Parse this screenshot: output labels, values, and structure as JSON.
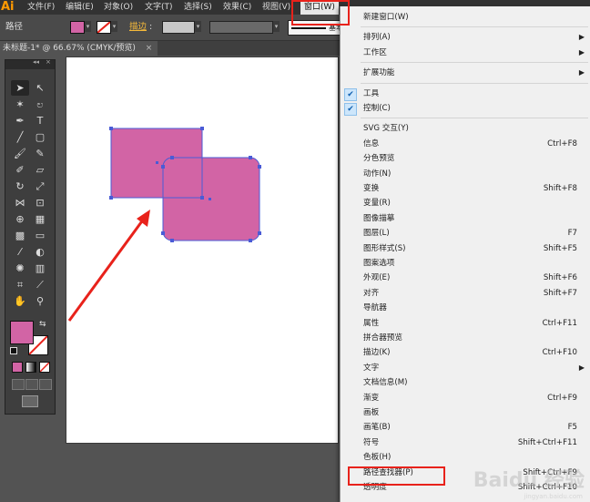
{
  "menubar": {
    "logo": "Ai",
    "items": [
      "文件(F)",
      "编辑(E)",
      "对象(O)",
      "文字(T)",
      "选择(S)",
      "效果(C)",
      "视图(V)",
      "窗口(W)"
    ]
  },
  "control": {
    "path_label": "路径",
    "stroke_label": "描边",
    "stroke_colon": ":",
    "preset": "基本",
    "fill_color": "#d264a5"
  },
  "tab": {
    "title": "未标题-1* @ 66.67% (CMYK/预览)",
    "close": "×"
  },
  "canvas": {
    "shape_fill": "#d264a5",
    "selection_color": "#4a5bd6",
    "arrow_color": "#e8221b"
  },
  "window_menu": {
    "items": [
      {
        "label": "新建窗口(W)",
        "shortcut": "",
        "submenu": false,
        "checked": false
      },
      {
        "sep": true
      },
      {
        "label": "排列(A)",
        "shortcut": "",
        "submenu": true,
        "checked": false
      },
      {
        "label": "工作区",
        "shortcut": "",
        "submenu": true,
        "checked": false
      },
      {
        "sep": true
      },
      {
        "label": "扩展功能",
        "shortcut": "",
        "submenu": true,
        "checked": false
      },
      {
        "sep": true
      },
      {
        "label": "工具",
        "shortcut": "",
        "submenu": false,
        "checked": true
      },
      {
        "label": "控制(C)",
        "shortcut": "",
        "submenu": false,
        "checked": true
      },
      {
        "sep": true
      },
      {
        "label": "SVG 交互(Y)",
        "shortcut": "",
        "submenu": false,
        "checked": false
      },
      {
        "label": "信息",
        "shortcut": "Ctrl+F8",
        "submenu": false,
        "checked": false
      },
      {
        "label": "分色预览",
        "shortcut": "",
        "submenu": false,
        "checked": false
      },
      {
        "label": "动作(N)",
        "shortcut": "",
        "submenu": false,
        "checked": false
      },
      {
        "label": "变换",
        "shortcut": "Shift+F8",
        "submenu": false,
        "checked": false
      },
      {
        "label": "变量(R)",
        "shortcut": "",
        "submenu": false,
        "checked": false
      },
      {
        "label": "图像描摹",
        "shortcut": "",
        "submenu": false,
        "checked": false
      },
      {
        "label": "图层(L)",
        "shortcut": "F7",
        "submenu": false,
        "checked": false
      },
      {
        "label": "图形样式(S)",
        "shortcut": "Shift+F5",
        "submenu": false,
        "checked": false
      },
      {
        "label": "图案选项",
        "shortcut": "",
        "submenu": false,
        "checked": false
      },
      {
        "label": "外观(E)",
        "shortcut": "Shift+F6",
        "submenu": false,
        "checked": false
      },
      {
        "label": "对齐",
        "shortcut": "Shift+F7",
        "submenu": false,
        "checked": false
      },
      {
        "label": "导航器",
        "shortcut": "",
        "submenu": false,
        "checked": false
      },
      {
        "label": "属性",
        "shortcut": "Ctrl+F11",
        "submenu": false,
        "checked": false
      },
      {
        "label": "拼合器预览",
        "shortcut": "",
        "submenu": false,
        "checked": false
      },
      {
        "label": "描边(K)",
        "shortcut": "Ctrl+F10",
        "submenu": false,
        "checked": false
      },
      {
        "label": "文字",
        "shortcut": "",
        "submenu": true,
        "checked": false
      },
      {
        "label": "文档信息(M)",
        "shortcut": "",
        "submenu": false,
        "checked": false
      },
      {
        "label": "渐变",
        "shortcut": "Ctrl+F9",
        "submenu": false,
        "checked": false
      },
      {
        "label": "画板",
        "shortcut": "",
        "submenu": false,
        "checked": false
      },
      {
        "label": "画笔(B)",
        "shortcut": "F5",
        "submenu": false,
        "checked": false
      },
      {
        "label": "符号",
        "shortcut": "Shift+Ctrl+F11",
        "submenu": false,
        "checked": false
      },
      {
        "label": "色板(H)",
        "shortcut": "",
        "submenu": false,
        "checked": false
      },
      {
        "label": "路径查找器(P)",
        "shortcut": "Shift+Ctrl+F9",
        "submenu": false,
        "checked": false
      },
      {
        "label": "透明度",
        "shortcut": "Shift+Ctrl+F10",
        "submenu": false,
        "checked": false
      }
    ]
  },
  "watermark": {
    "text": "Baidu 经验",
    "sub": "jingyan.baidu.com"
  }
}
